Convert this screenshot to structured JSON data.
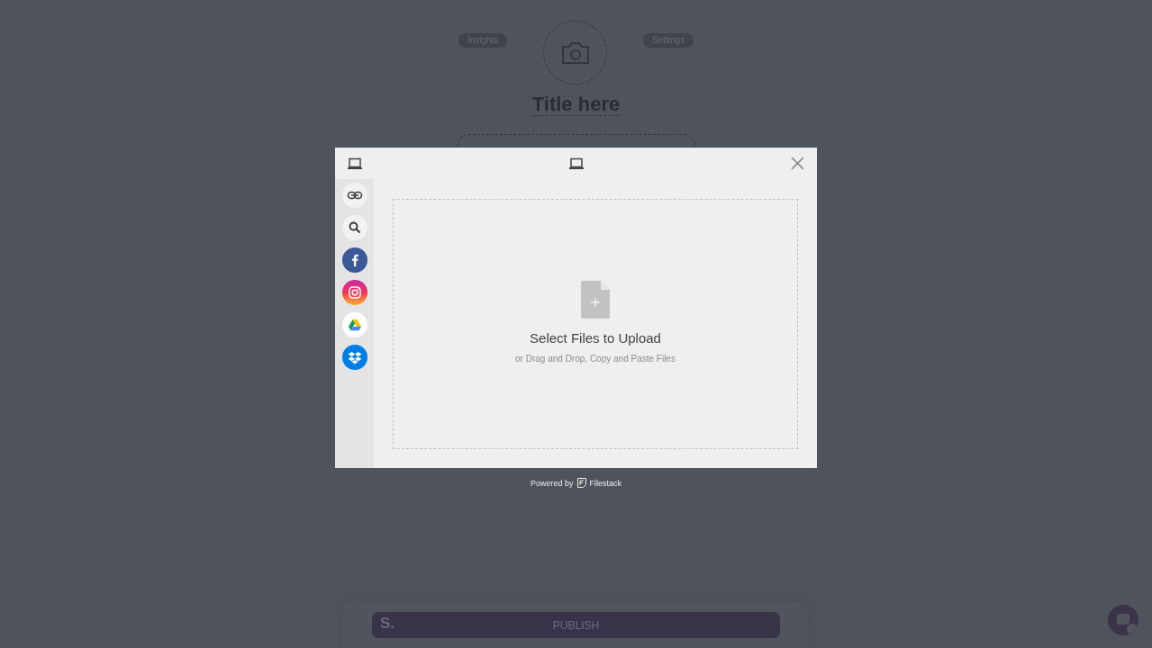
{
  "background": {
    "nav": [
      {
        "label": "Insights"
      },
      {
        "label": "Settings"
      }
    ],
    "title": "Title here",
    "publish_bar": {
      "logo": "S.",
      "button": "PUBLISH"
    }
  },
  "picker": {
    "sources": [
      {
        "kind": "link"
      },
      {
        "kind": "search"
      },
      {
        "kind": "facebook"
      },
      {
        "kind": "instagram"
      },
      {
        "kind": "drive"
      },
      {
        "kind": "dropbox"
      }
    ],
    "dropzone": {
      "title": "Select Files to Upload",
      "hint": "or Drag and Drop, Copy and Paste Files"
    }
  },
  "footer": {
    "prefix": "Powered by",
    "brand": "Filestack"
  }
}
